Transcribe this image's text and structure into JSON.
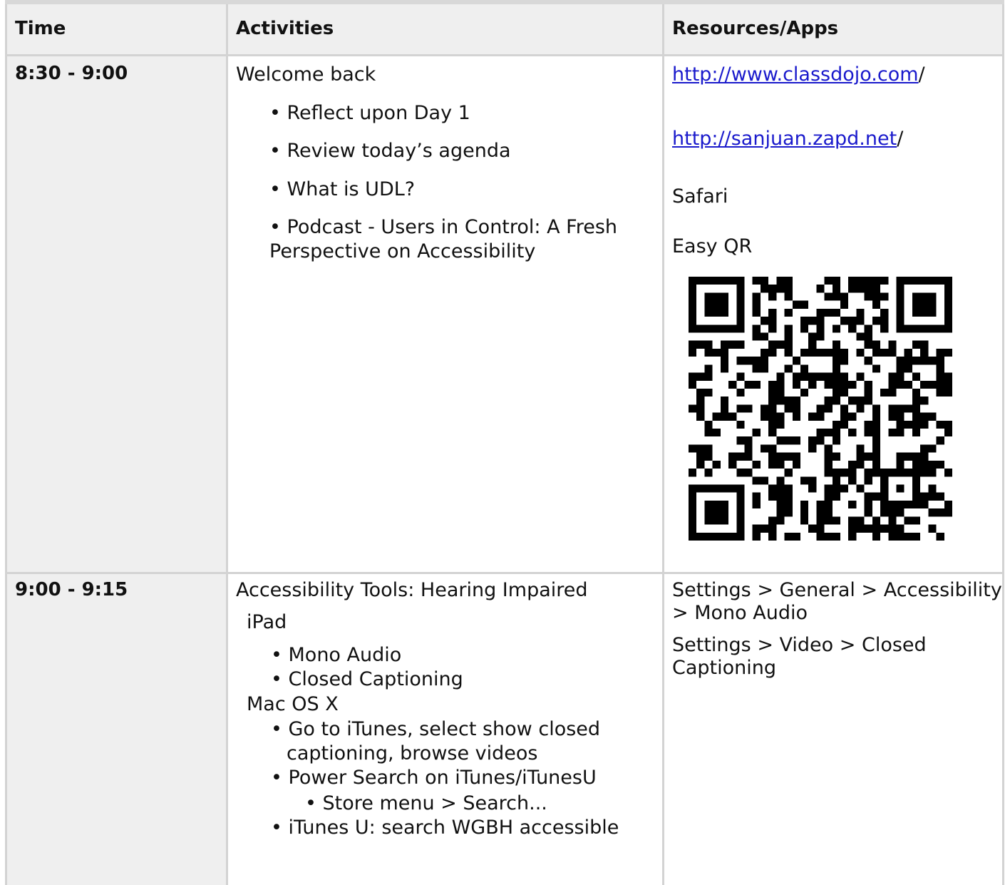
{
  "headers": {
    "time": "Time",
    "activities": "Activities",
    "resources": "Resources/Apps"
  },
  "rows": [
    {
      "time": "8:30 - 9:00",
      "activities": {
        "title": "Welcome back",
        "bullets": [
          "• Reflect upon Day 1",
          "• Review today’s agenda",
          "• What is UDL?",
          "• Podcast - Users in Control: A Fresh",
          "Perspective on Accessibility"
        ]
      },
      "resources": {
        "link1": "http://www.classdojo.com",
        "link1_suffix": "/",
        "link2": "http://sanjuan.zapd.net",
        "link2_suffix": "/",
        "app1": "Safari",
        "app2": "Easy QR"
      }
    },
    {
      "time": "9:00 - 9:15",
      "activities": {
        "title": "Accessibility Tools: Hearing Impaired",
        "ipad_label": "iPad",
        "ipad_items": [
          "• Mono Audio",
          "• Closed Captioning"
        ],
        "mac_label": "Mac OS X",
        "mac_items": [
          "• Go to iTunes, select show closed",
          "captioning, browse videos",
          "• Power Search on iTunes/iTunesU",
          "• Store menu > Search...",
          "• iTunes U: search WGBH accessible"
        ]
      },
      "resources": {
        "line1": "Settings > General > Accessibility",
        "line2": "> Mono Audio",
        "line3": "Settings > Video > Closed",
        "line4": "Captioning"
      }
    }
  ]
}
